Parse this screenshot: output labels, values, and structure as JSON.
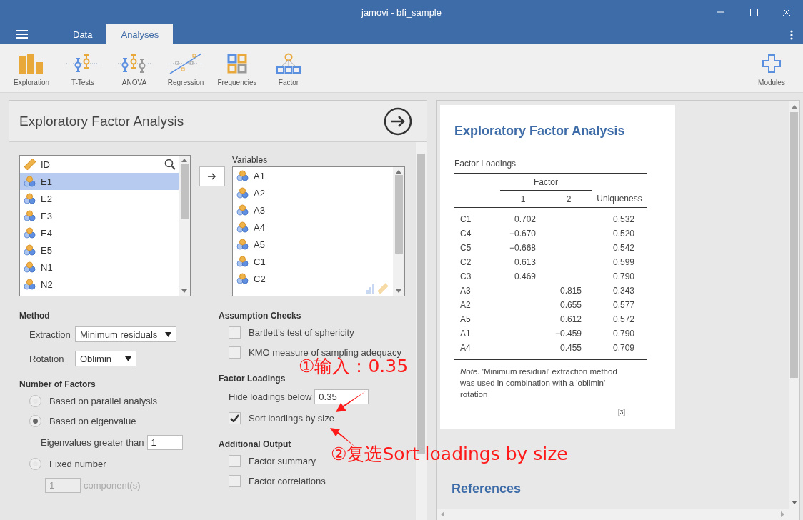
{
  "window": {
    "title": "jamovi - bfi_sample"
  },
  "tabs": [
    {
      "label": "Data",
      "selected": false
    },
    {
      "label": "Analyses",
      "selected": true
    }
  ],
  "toolbar": [
    {
      "label": "Exploration",
      "kind": "bars"
    },
    {
      "label": "T-Tests",
      "kind": "ttest"
    },
    {
      "label": "ANOVA",
      "kind": "anova"
    },
    {
      "label": "Regression",
      "kind": "regression"
    },
    {
      "label": "Frequencies",
      "kind": "frequencies"
    },
    {
      "label": "Factor",
      "kind": "factor"
    }
  ],
  "modules": {
    "label": "Modules"
  },
  "analysis": {
    "title": "Exploratory Factor Analysis",
    "source_list": [
      {
        "name": "ID",
        "kind": "id",
        "selected": false
      },
      {
        "name": "E1",
        "kind": "ordinal",
        "selected": true
      },
      {
        "name": "E2",
        "kind": "ordinal",
        "selected": false
      },
      {
        "name": "E3",
        "kind": "ordinal",
        "selected": false
      },
      {
        "name": "E4",
        "kind": "ordinal",
        "selected": false
      },
      {
        "name": "E5",
        "kind": "ordinal",
        "selected": false
      },
      {
        "name": "N1",
        "kind": "ordinal",
        "selected": false
      },
      {
        "name": "N2",
        "kind": "ordinal",
        "selected": false
      }
    ],
    "variables_label": "Variables",
    "variables": [
      {
        "name": "A1"
      },
      {
        "name": "A2"
      },
      {
        "name": "A3"
      },
      {
        "name": "A4"
      },
      {
        "name": "A5"
      },
      {
        "name": "C1"
      },
      {
        "name": "C2"
      }
    ],
    "method": {
      "heading": "Method",
      "extraction_label": "Extraction",
      "extraction": "Minimum residuals",
      "rotation_label": "Rotation",
      "rotation": "Oblimin"
    },
    "number_of_factors": {
      "heading": "Number of Factors",
      "options": [
        {
          "label": "Based on parallel analysis",
          "selected": false
        },
        {
          "label": "Based on eigenvalue",
          "selected": true
        },
        {
          "label": "Fixed number",
          "selected": false
        }
      ],
      "eigen_label": "Eigenvalues greater than",
      "eigen_value": "1",
      "fixed_value": "1",
      "fixed_unit": "component(s)",
      "fixed_disabled": true
    },
    "assumption_checks": {
      "heading": "Assumption Checks",
      "items": [
        {
          "label": "Bartlett's test of sphericity",
          "checked": false
        },
        {
          "label": "KMO measure of sampling adequacy",
          "checked": false
        }
      ]
    },
    "factor_loadings": {
      "heading": "Factor Loadings",
      "hide_label": "Hide loadings below",
      "hide_value": "0.35",
      "sort_label": "Sort loadings by size",
      "sort_checked": true
    },
    "additional_output": {
      "heading": "Additional Output",
      "items": [
        {
          "label": "Factor summary",
          "checked": false
        },
        {
          "label": "Factor correlations",
          "checked": false
        }
      ]
    }
  },
  "results": {
    "title": "Exploratory Factor Analysis",
    "table_title": "Factor Loadings",
    "group_header": "Factor",
    "columns": [
      "1",
      "2",
      "Uniqueness"
    ],
    "rows": [
      {
        "label": "C1",
        "cells": [
          "0.702",
          "",
          "0.532"
        ]
      },
      {
        "label": "C4",
        "cells": [
          "−0.670",
          "",
          "0.520"
        ]
      },
      {
        "label": "C5",
        "cells": [
          "−0.668",
          "",
          "0.542"
        ]
      },
      {
        "label": "C2",
        "cells": [
          "0.613",
          "",
          "0.599"
        ]
      },
      {
        "label": "C3",
        "cells": [
          "0.469",
          "",
          "0.790"
        ]
      },
      {
        "label": "A3",
        "cells": [
          "",
          "0.815",
          "0.343"
        ]
      },
      {
        "label": "A2",
        "cells": [
          "",
          "0.655",
          "0.577"
        ]
      },
      {
        "label": "A5",
        "cells": [
          "",
          "0.612",
          "0.572"
        ]
      },
      {
        "label": "A1",
        "cells": [
          "",
          "−0.459",
          "0.790"
        ]
      },
      {
        "label": "A4",
        "cells": [
          "",
          "0.455",
          "0.709"
        ]
      }
    ],
    "note": "*Note.* 'Minimum residual' extraction method was used in combination with a 'oblimin' rotation",
    "reference_mark": "[3]",
    "references_title": "References"
  },
  "annotations": [
    {
      "text": "①输入：0.35"
    },
    {
      "text": "②复选Sort loadings by size"
    }
  ]
}
